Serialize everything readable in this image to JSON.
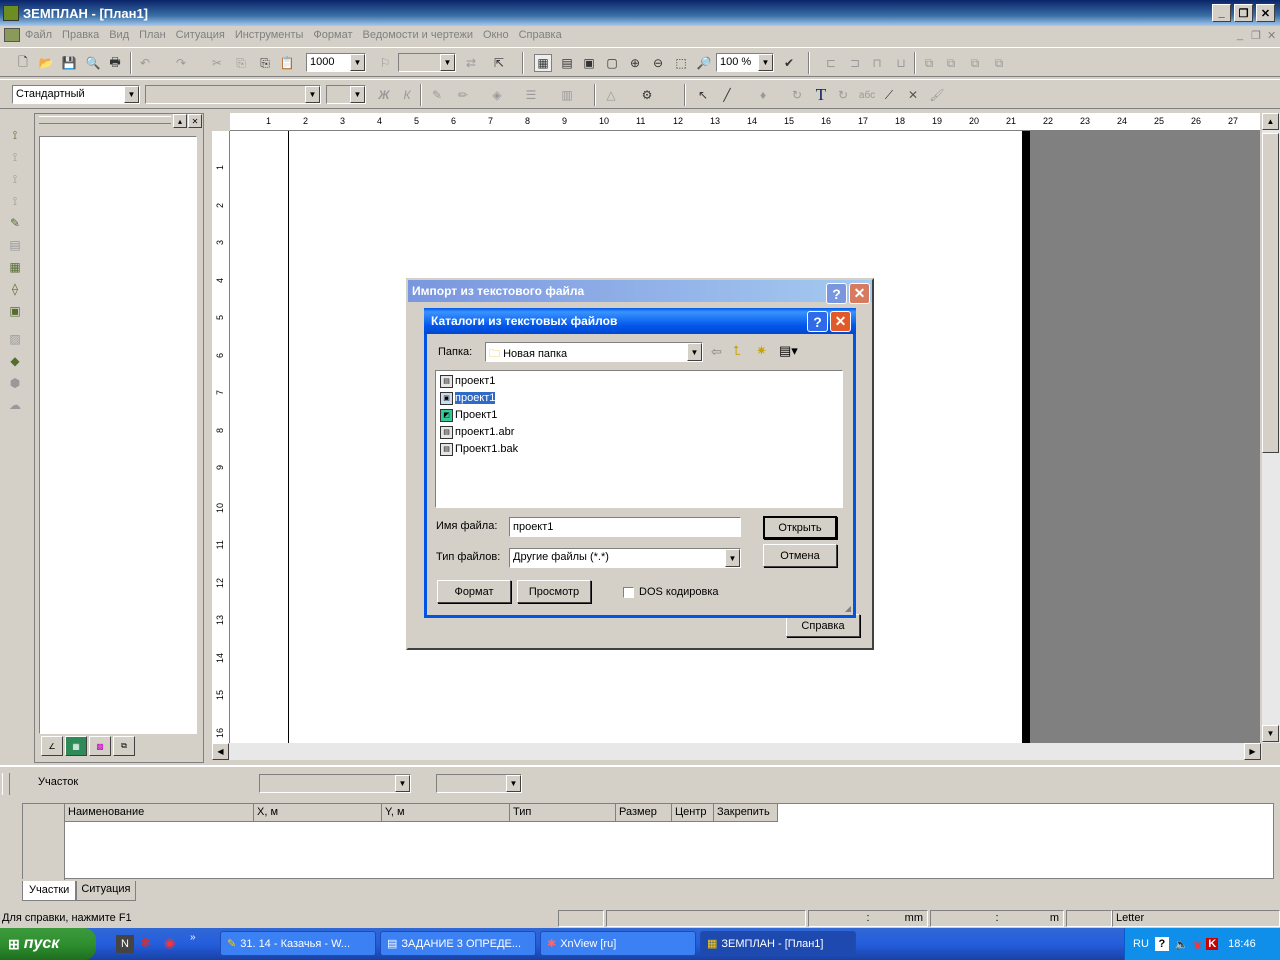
{
  "app": {
    "title": "ЗЕМПЛАН - [План1]"
  },
  "menu": [
    "Файл",
    "Правка",
    "Вид",
    "План",
    "Ситуация",
    "Инструменты",
    "Формат",
    "Ведомости и чертежи",
    "Окно",
    "Справка"
  ],
  "toolbar1": {
    "scale_value": "1000",
    "zoom_value": "100 %"
  },
  "toolbar2": {
    "style_value": "Стандартный",
    "bold_label": "Ж",
    "italic_label": "К",
    "text_tool_label": "T",
    "abc_label": "абс"
  },
  "ruler": {
    "top": [
      "1",
      "2",
      "3",
      "4",
      "5",
      "6",
      "7",
      "8",
      "9",
      "10",
      "11",
      "12",
      "13",
      "14",
      "15",
      "16",
      "17",
      "18",
      "19",
      "20",
      "21",
      "22",
      "23",
      "24",
      "25",
      "26",
      "27"
    ],
    "left": [
      "1",
      "2",
      "3",
      "4",
      "5",
      "6",
      "7",
      "8",
      "9",
      "10",
      "11",
      "12",
      "13",
      "14",
      "15",
      "16"
    ]
  },
  "bottom": {
    "section_label": "Участок",
    "columns": [
      "Наименование",
      "X, м",
      "Y, м",
      "Тип",
      "Размер",
      "Центр",
      "Закрепить"
    ],
    "tabs": [
      "Участки",
      "Ситуация"
    ]
  },
  "status": {
    "help_text": "Для справки, нажмите F1",
    "cell1": ":",
    "cell2": "mm",
    "cell3": ":",
    "cell4": "m",
    "paper": "Letter"
  },
  "outer_dialog": {
    "title": "Импорт из текстового файла",
    "help_button": "Справка"
  },
  "dialog": {
    "title": "Каталоги из текстовых файлов",
    "folder_label": "Папка:",
    "folder_value": "Новая папка",
    "files": [
      {
        "name": "проект1",
        "selected": false
      },
      {
        "name": "проект1",
        "selected": true
      },
      {
        "name": "Проект1",
        "selected": false
      },
      {
        "name": "проект1.abr",
        "selected": false
      },
      {
        "name": "Проект1.bak",
        "selected": false
      }
    ],
    "filename_label": "Имя файла:",
    "filename_value": "проект1",
    "filetype_label": "Тип файлов:",
    "filetype_value": "Другие файлы (*.*)",
    "open_button": "Открыть",
    "cancel_button": "Отмена",
    "format_button": "Формат",
    "preview_button": "Просмотр",
    "dos_label": "DOS кодировка",
    "help_icon": "?",
    "close_icon": "✕"
  },
  "taskbar": {
    "start_label": "пуск",
    "tasks": [
      "31. 14 - Казачья - W...",
      "ЗАДАНИЕ 3 ОПРЕДЕ...",
      "XnView [ru]",
      "ЗЕМПЛАН - [План1]"
    ],
    "lang": "RU",
    "clock": "18:46"
  },
  "colors": {
    "title_active": "#0a246a",
    "xp_blue": "#245edc",
    "dialog_inactive": "#7a96df",
    "selection": "#316ac5"
  }
}
